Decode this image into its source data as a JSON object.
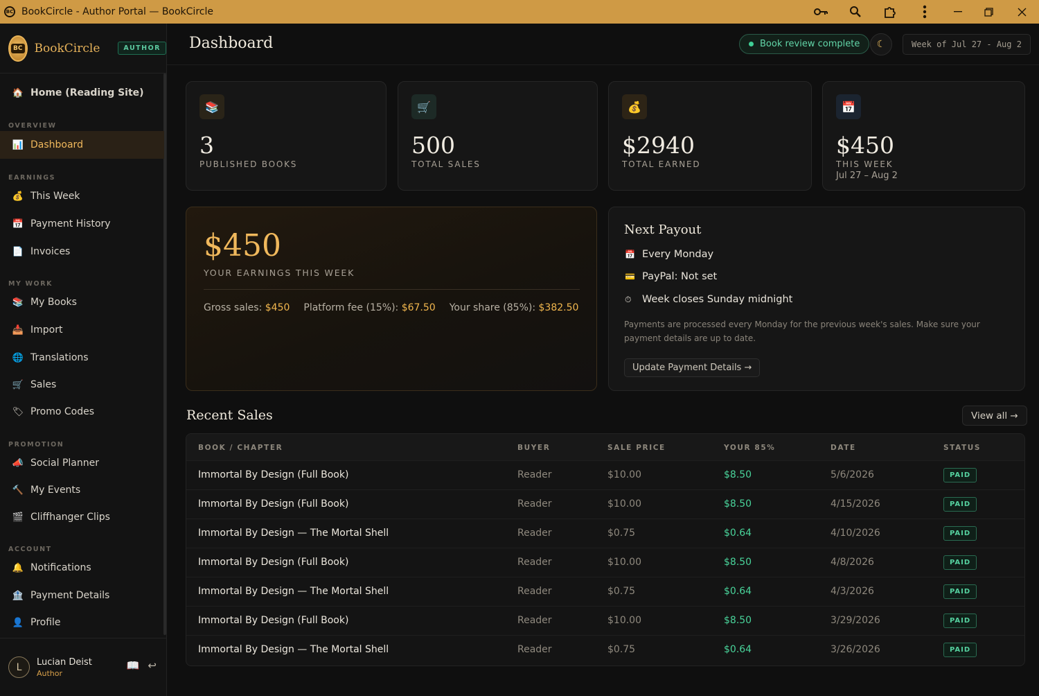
{
  "window": {
    "title": "BookCircle - Author Portal — BookCircle"
  },
  "brand": {
    "logo_text": "BC",
    "name": "BookCircle",
    "badge": "AUTHOR"
  },
  "sidebar": {
    "home": "Home (Reading Site)",
    "sections": [
      {
        "title": "OVERVIEW",
        "items": [
          {
            "label": "Dashboard",
            "icon": "chart-icon",
            "active": true
          }
        ]
      },
      {
        "title": "EARNINGS",
        "items": [
          {
            "label": "This Week",
            "icon": "money-bag-icon"
          },
          {
            "label": "Payment History",
            "icon": "calendar-icon"
          },
          {
            "label": "Invoices",
            "icon": "document-icon"
          }
        ]
      },
      {
        "title": "MY WORK",
        "items": [
          {
            "label": "My Books",
            "icon": "books-icon"
          },
          {
            "label": "Import",
            "icon": "inbox-icon"
          },
          {
            "label": "Translations",
            "icon": "globe-icon"
          },
          {
            "label": "Sales",
            "icon": "cart-icon"
          },
          {
            "label": "Promo Codes",
            "icon": "tag-icon"
          }
        ]
      },
      {
        "title": "PROMOTION",
        "items": [
          {
            "label": "Social Planner",
            "icon": "megaphone-icon"
          },
          {
            "label": "My Events",
            "icon": "hammer-icon"
          },
          {
            "label": "Cliffhanger Clips",
            "icon": "clapper-icon"
          }
        ]
      },
      {
        "title": "ACCOUNT",
        "items": [
          {
            "label": "Notifications",
            "icon": "bell-icon"
          },
          {
            "label": "Payment Details",
            "icon": "bank-icon"
          },
          {
            "label": "Profile",
            "icon": "user-icon"
          }
        ]
      }
    ],
    "user": {
      "initial": "L",
      "name": "Lucian Deist",
      "role": "Author"
    }
  },
  "header": {
    "title": "Dashboard",
    "status": "Book review complete",
    "week_range": "Week of Jul 27 - Aug 2"
  },
  "stats": [
    {
      "value": "3",
      "label": "PUBLISHED BOOKS",
      "icon": "books-icon"
    },
    {
      "value": "500",
      "label": "TOTAL SALES",
      "icon": "cart-icon"
    },
    {
      "value": "$2940",
      "label": "TOTAL EARNED",
      "icon": "money-bag-icon"
    },
    {
      "value": "$450",
      "label": "THIS WEEK",
      "sub": "Jul 27 – Aug 2",
      "icon": "calendar-icon"
    }
  ],
  "earnings": {
    "value": "$450",
    "label": "YOUR EARNINGS THIS WEEK",
    "gross_label": "Gross sales:",
    "gross_value": "$450",
    "fee_label": "Platform fee (15%):",
    "fee_value": "$67.50",
    "share_label": "Your share (85%):",
    "share_value": "$382.50"
  },
  "payout": {
    "title": "Next Payout",
    "schedule": "Every Monday",
    "paypal": "PayPal: Not set",
    "closes": "Week closes Sunday midnight",
    "note": "Payments are processed every Monday for the previous week's sales. Make sure your payment details are up to date.",
    "button": "Update Payment Details →"
  },
  "recent_sales": {
    "title": "Recent Sales",
    "view_all": "View all →",
    "columns": [
      "BOOK / CHAPTER",
      "BUYER",
      "SALE PRICE",
      "YOUR 85%",
      "DATE",
      "STATUS"
    ],
    "rows": [
      {
        "book": "Immortal By Design (Full Book)",
        "buyer": "Reader",
        "price": "$10.00",
        "share": "$8.50",
        "date": "5/6/2026",
        "status": "PAID"
      },
      {
        "book": "Immortal By Design (Full Book)",
        "buyer": "Reader",
        "price": "$10.00",
        "share": "$8.50",
        "date": "4/15/2026",
        "status": "PAID"
      },
      {
        "book": "Immortal By Design — The Mortal Shell",
        "buyer": "Reader",
        "price": "$0.75",
        "share": "$0.64",
        "date": "4/10/2026",
        "status": "PAID"
      },
      {
        "book": "Immortal By Design (Full Book)",
        "buyer": "Reader",
        "price": "$10.00",
        "share": "$8.50",
        "date": "4/8/2026",
        "status": "PAID"
      },
      {
        "book": "Immortal By Design — The Mortal Shell",
        "buyer": "Reader",
        "price": "$0.75",
        "share": "$0.64",
        "date": "4/3/2026",
        "status": "PAID"
      },
      {
        "book": "Immortal By Design (Full Book)",
        "buyer": "Reader",
        "price": "$10.00",
        "share": "$8.50",
        "date": "3/29/2026",
        "status": "PAID"
      },
      {
        "book": "Immortal By Design — The Mortal Shell",
        "buyer": "Reader",
        "price": "$0.75",
        "share": "$0.64",
        "date": "3/26/2026",
        "status": "PAID"
      }
    ]
  },
  "colors": {
    "accent": "#f0b85c",
    "titlebar": "#cf9a45",
    "success": "#49d39a"
  }
}
